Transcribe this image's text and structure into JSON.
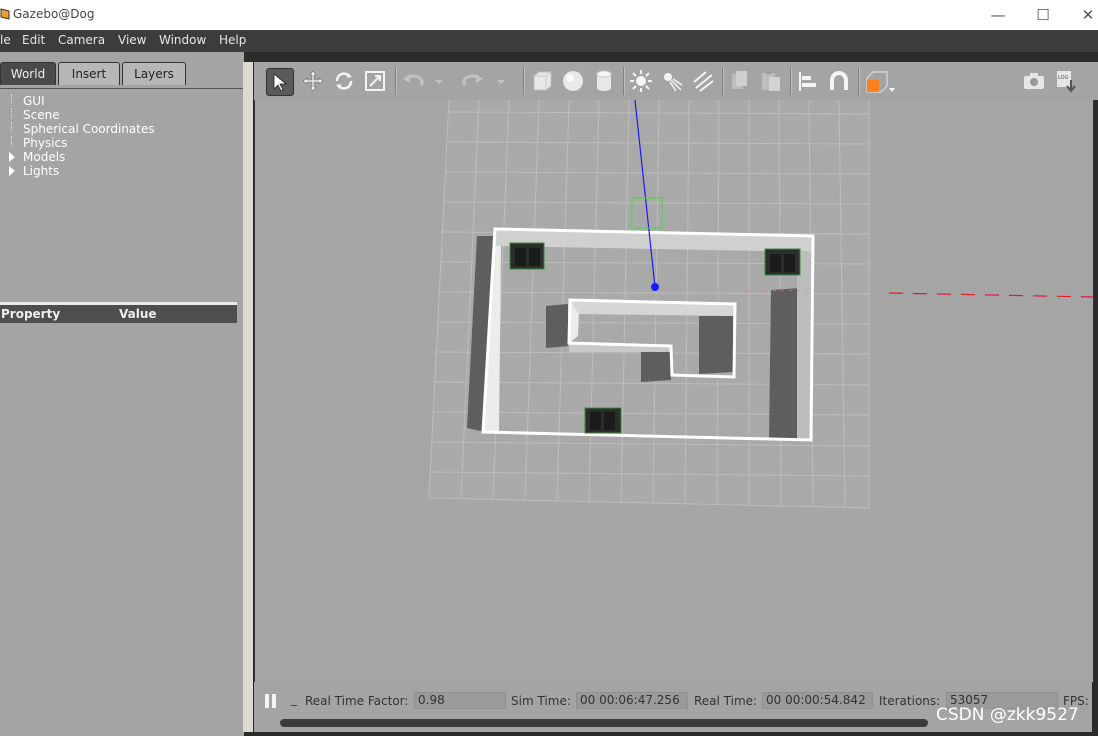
{
  "window": {
    "title": "Gazebo@Dog",
    "minimize": "—",
    "maximize": "☐",
    "close": "✕"
  },
  "menu": [
    {
      "label": "le"
    },
    {
      "label": "Edit"
    },
    {
      "label": "Camera"
    },
    {
      "label": "View"
    },
    {
      "label": "Window"
    },
    {
      "label": "Help"
    }
  ],
  "tabs": [
    {
      "label": "World"
    },
    {
      "label": "Insert"
    },
    {
      "label": "Layers"
    }
  ],
  "tree": [
    {
      "label": "GUI"
    },
    {
      "label": "Scene"
    },
    {
      "label": "Spherical Coordinates"
    },
    {
      "label": "Physics"
    },
    {
      "label": "Models"
    },
    {
      "label": "Lights"
    }
  ],
  "properties": {
    "col_property": "Property",
    "col_value": "Value"
  },
  "toolbar_icons": [
    "select-arrow-icon",
    "translate-icon",
    "rotate-icon",
    "scale-icon",
    "undo-icon",
    "redo-icon",
    "box-icon",
    "sphere-icon",
    "cylinder-icon",
    "point-light-icon",
    "spot-light-icon",
    "directional-light-icon",
    "copy-icon",
    "paste-icon",
    "align-icon",
    "snap-icon",
    "view-angle-icon",
    "screenshot-icon",
    "log-icon"
  ],
  "status": {
    "rtf_label": "Real Time Factor:",
    "rtf_value": "0.98",
    "sim_label": "Sim Time:",
    "sim_value": "00 00:06:47.256",
    "real_label": "Real Time:",
    "real_value": "00 00:00:54.842",
    "iter_label": "Iterations:",
    "iter_value": "53057",
    "fps_label": "FPS:",
    "step_label": "_"
  },
  "watermark": "CSDN @zkk9527",
  "colors": {
    "accent_orange": "#ff7f1a",
    "grid": "#bdbdbd",
    "axis_blue": "#1a1aff",
    "axis_red": "#e02020"
  }
}
